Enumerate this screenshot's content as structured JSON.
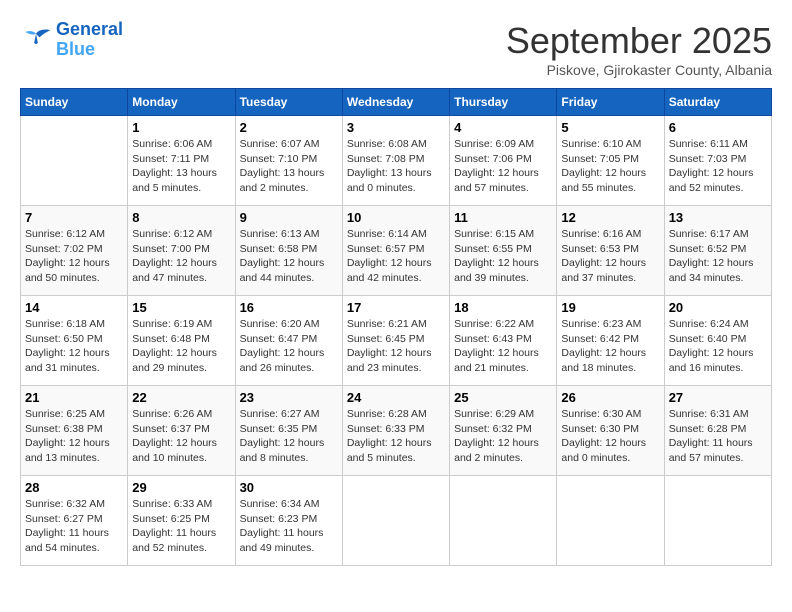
{
  "header": {
    "logo_line1": "General",
    "logo_line2": "Blue",
    "month_title": "September 2025",
    "location": "Piskove, Gjirokaster County, Albania"
  },
  "days_of_week": [
    "Sunday",
    "Monday",
    "Tuesday",
    "Wednesday",
    "Thursday",
    "Friday",
    "Saturday"
  ],
  "weeks": [
    [
      {
        "day": "",
        "info": ""
      },
      {
        "day": "1",
        "info": "Sunrise: 6:06 AM\nSunset: 7:11 PM\nDaylight: 13 hours\nand 5 minutes."
      },
      {
        "day": "2",
        "info": "Sunrise: 6:07 AM\nSunset: 7:10 PM\nDaylight: 13 hours\nand 2 minutes."
      },
      {
        "day": "3",
        "info": "Sunrise: 6:08 AM\nSunset: 7:08 PM\nDaylight: 13 hours\nand 0 minutes."
      },
      {
        "day": "4",
        "info": "Sunrise: 6:09 AM\nSunset: 7:06 PM\nDaylight: 12 hours\nand 57 minutes."
      },
      {
        "day": "5",
        "info": "Sunrise: 6:10 AM\nSunset: 7:05 PM\nDaylight: 12 hours\nand 55 minutes."
      },
      {
        "day": "6",
        "info": "Sunrise: 6:11 AM\nSunset: 7:03 PM\nDaylight: 12 hours\nand 52 minutes."
      }
    ],
    [
      {
        "day": "7",
        "info": "Sunrise: 6:12 AM\nSunset: 7:02 PM\nDaylight: 12 hours\nand 50 minutes."
      },
      {
        "day": "8",
        "info": "Sunrise: 6:12 AM\nSunset: 7:00 PM\nDaylight: 12 hours\nand 47 minutes."
      },
      {
        "day": "9",
        "info": "Sunrise: 6:13 AM\nSunset: 6:58 PM\nDaylight: 12 hours\nand 44 minutes."
      },
      {
        "day": "10",
        "info": "Sunrise: 6:14 AM\nSunset: 6:57 PM\nDaylight: 12 hours\nand 42 minutes."
      },
      {
        "day": "11",
        "info": "Sunrise: 6:15 AM\nSunset: 6:55 PM\nDaylight: 12 hours\nand 39 minutes."
      },
      {
        "day": "12",
        "info": "Sunrise: 6:16 AM\nSunset: 6:53 PM\nDaylight: 12 hours\nand 37 minutes."
      },
      {
        "day": "13",
        "info": "Sunrise: 6:17 AM\nSunset: 6:52 PM\nDaylight: 12 hours\nand 34 minutes."
      }
    ],
    [
      {
        "day": "14",
        "info": "Sunrise: 6:18 AM\nSunset: 6:50 PM\nDaylight: 12 hours\nand 31 minutes."
      },
      {
        "day": "15",
        "info": "Sunrise: 6:19 AM\nSunset: 6:48 PM\nDaylight: 12 hours\nand 29 minutes."
      },
      {
        "day": "16",
        "info": "Sunrise: 6:20 AM\nSunset: 6:47 PM\nDaylight: 12 hours\nand 26 minutes."
      },
      {
        "day": "17",
        "info": "Sunrise: 6:21 AM\nSunset: 6:45 PM\nDaylight: 12 hours\nand 23 minutes."
      },
      {
        "day": "18",
        "info": "Sunrise: 6:22 AM\nSunset: 6:43 PM\nDaylight: 12 hours\nand 21 minutes."
      },
      {
        "day": "19",
        "info": "Sunrise: 6:23 AM\nSunset: 6:42 PM\nDaylight: 12 hours\nand 18 minutes."
      },
      {
        "day": "20",
        "info": "Sunrise: 6:24 AM\nSunset: 6:40 PM\nDaylight: 12 hours\nand 16 minutes."
      }
    ],
    [
      {
        "day": "21",
        "info": "Sunrise: 6:25 AM\nSunset: 6:38 PM\nDaylight: 12 hours\nand 13 minutes."
      },
      {
        "day": "22",
        "info": "Sunrise: 6:26 AM\nSunset: 6:37 PM\nDaylight: 12 hours\nand 10 minutes."
      },
      {
        "day": "23",
        "info": "Sunrise: 6:27 AM\nSunset: 6:35 PM\nDaylight: 12 hours\nand 8 minutes."
      },
      {
        "day": "24",
        "info": "Sunrise: 6:28 AM\nSunset: 6:33 PM\nDaylight: 12 hours\nand 5 minutes."
      },
      {
        "day": "25",
        "info": "Sunrise: 6:29 AM\nSunset: 6:32 PM\nDaylight: 12 hours\nand 2 minutes."
      },
      {
        "day": "26",
        "info": "Sunrise: 6:30 AM\nSunset: 6:30 PM\nDaylight: 12 hours\nand 0 minutes."
      },
      {
        "day": "27",
        "info": "Sunrise: 6:31 AM\nSunset: 6:28 PM\nDaylight: 11 hours\nand 57 minutes."
      }
    ],
    [
      {
        "day": "28",
        "info": "Sunrise: 6:32 AM\nSunset: 6:27 PM\nDaylight: 11 hours\nand 54 minutes."
      },
      {
        "day": "29",
        "info": "Sunrise: 6:33 AM\nSunset: 6:25 PM\nDaylight: 11 hours\nand 52 minutes."
      },
      {
        "day": "30",
        "info": "Sunrise: 6:34 AM\nSunset: 6:23 PM\nDaylight: 11 hours\nand 49 minutes."
      },
      {
        "day": "",
        "info": ""
      },
      {
        "day": "",
        "info": ""
      },
      {
        "day": "",
        "info": ""
      },
      {
        "day": "",
        "info": ""
      }
    ]
  ]
}
